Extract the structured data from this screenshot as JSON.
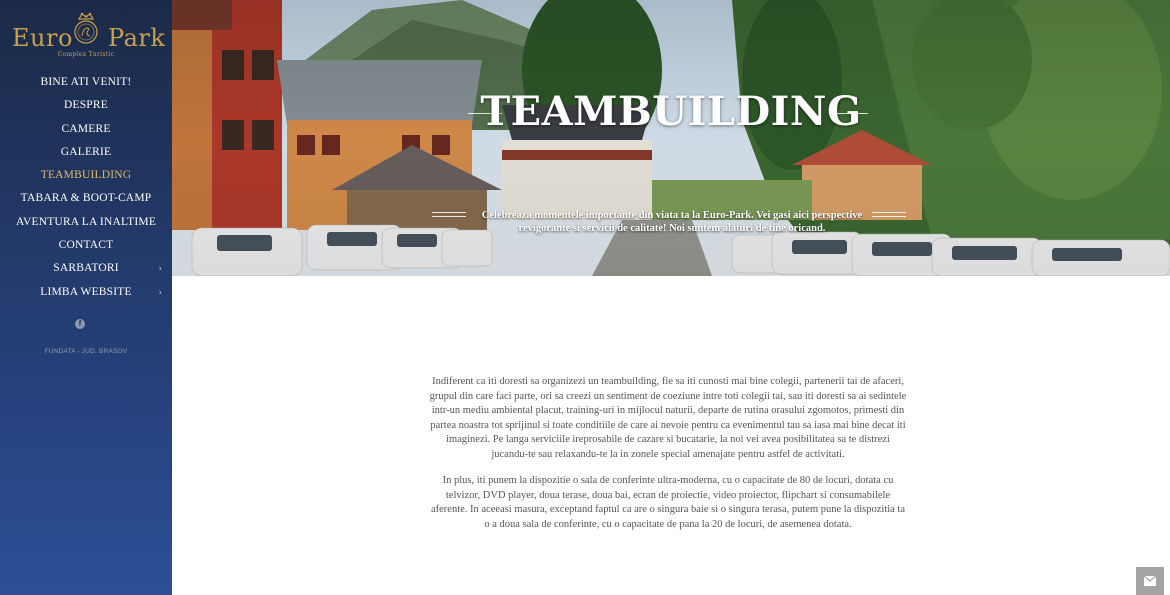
{
  "brand": {
    "name_left": "Euro",
    "name_right": "Park",
    "tagline": "Complex Turistic",
    "color": "#c9a04a"
  },
  "sidebar": {
    "items": [
      {
        "label": "BINE ATI VENIT!",
        "active": false,
        "has_submenu": false
      },
      {
        "label": "DESPRE",
        "active": false,
        "has_submenu": false
      },
      {
        "label": "CAMERE",
        "active": false,
        "has_submenu": false
      },
      {
        "label": "GALERIE",
        "active": false,
        "has_submenu": false
      },
      {
        "label": "TEAMBUILDING",
        "active": true,
        "has_submenu": false
      },
      {
        "label": "TABARA & BOOT-CAMP",
        "active": false,
        "has_submenu": false
      },
      {
        "label": "AVENTURA LA INALTIME",
        "active": false,
        "has_submenu": false
      },
      {
        "label": "CONTACT",
        "active": false,
        "has_submenu": false
      },
      {
        "label": "SARBATORI",
        "active": false,
        "has_submenu": true
      },
      {
        "label": "LIMBA WEBSITE",
        "active": false,
        "has_submenu": true
      }
    ],
    "chevron_glyph": "›",
    "social_icon": "facebook-icon",
    "social_glyph": "f",
    "address": "FUNDATA - JUD. BRASOV",
    "active_color": "#e0bc6b"
  },
  "hero": {
    "title": "TEAMBUILDING",
    "subtitle": "Celebreaza momentele importante din viata ta la Euro-Park. Vei gasi aici perspective revigorante si servicii de calitate! Noi suntem alaturi de tine oricand."
  },
  "content": {
    "paragraphs": [
      "Indiferent ca iti doresti sa organizezi un teambuilding, fie sa iti cunosti mai bine colegii, partenerii tai de afaceri, grupul din care faci parte, ori sa creezi un sentiment de coeziune intre toti colegii tai, sau iti doresti sa ai sedintele intr-un mediu ambiental placut, training-uri in mijlocul naturii, departe de rutina orasului zgomotos, primesti din partea noastra tot sprijinul si toate conditiile de care ai nevoie pentru ca evenimentul tau sa iasa mai bine decat iti imaginezi. Pe langa serviciile ireprosabile de cazare si bucatarie, la noi vei avea posibilitatea sa te distrezi jucandu-te sau relaxandu-te la in zonele special amenajate pentru astfel de activitati.",
      "In plus, iti punem la dispozitie o sala de conferinte ultra-moderna, cu o capacitate de 80 de locuri, dotata cu telvizor, DVD player, doua terase, doua bai, ecran de proiectie, video proiector, flipchart si consumabilele aferente. In aceeasi masura, exceptand faptul ca are o singura baie si o singura terasa, putem pune la dispozitia ta o a doua sala de conferinte, cu o capacitate de pana la 20 de locuri, de asemenea dotata."
    ]
  },
  "widgets": {
    "contact_button_icon": "envelope-icon"
  }
}
